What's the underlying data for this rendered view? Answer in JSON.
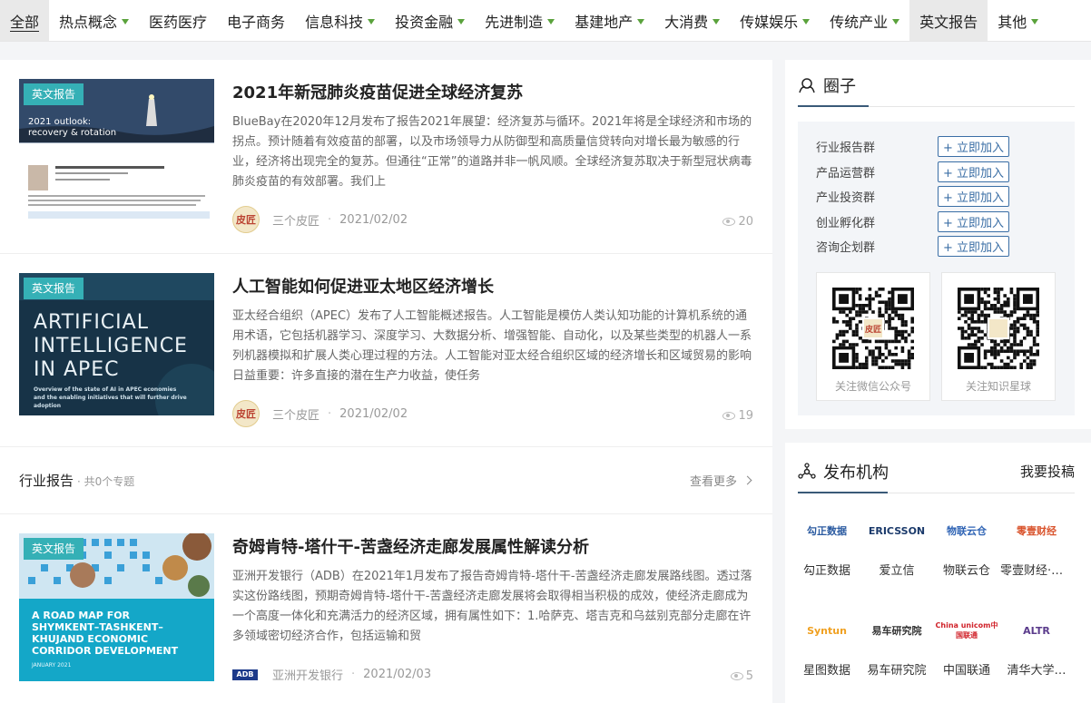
{
  "nav": {
    "items": [
      {
        "label": "全部",
        "caret": false
      },
      {
        "label": "热点概念",
        "caret": true
      },
      {
        "label": "医药医疗",
        "caret": false
      },
      {
        "label": "电子商务",
        "caret": false
      },
      {
        "label": "信息科技",
        "caret": true
      },
      {
        "label": "投资金融",
        "caret": true
      },
      {
        "label": "先进制造",
        "caret": true
      },
      {
        "label": "基建地产",
        "caret": true
      },
      {
        "label": "大消费",
        "caret": true
      },
      {
        "label": "传媒娱乐",
        "caret": true
      },
      {
        "label": "传统产业",
        "caret": true
      },
      {
        "label": "英文报告",
        "caret": false
      },
      {
        "label": "其他",
        "caret": true
      }
    ]
  },
  "articles": [
    {
      "badge": "英文报告",
      "thumb_lines": [
        "2021 outlook:",
        "recovery & rotation"
      ],
      "title": "2021年新冠肺炎疫苗促进全球经济复苏",
      "desc": "BlueBay在2020年12月发布了报告2021年展望：经济复苏与循环。2021年将是全球经济和市场的拐点。预计随着有效疫苗的部署，以及市场领导力从防御型和高质量信贷转向对增长最为敏感的行业，经济将出现完全的复苏。但通往“正常”的道路并非一帆风顺。全球经济复苏取决于新型冠状病毒肺炎疫苗的有效部署。我们上",
      "author": "三个皮匠",
      "avatar_text": "皮匠",
      "date": "2021/02/02",
      "views": "20"
    },
    {
      "badge": "英文报告",
      "thumb_lines": [
        "ARTIFICIAL",
        "INTELLIGENCE",
        "IN APEC",
        "Overview of the state of AI in APEC economies",
        "and the enabling initiatives that will further drive adoption"
      ],
      "title": "人工智能如何促进亚太地区经济增长",
      "desc": "亚太经合组织（APEC）发布了人工智能概述报告。人工智能是模仿人类认知功能的计算机系统的通用术语，它包括机器学习、深度学习、大数据分析、增强智能、自动化，以及某些类型的机器人一系列机器模拟和扩展人类心理过程的方法。人工智能对亚太经合组织区域的经济增长和区域贸易的影响日益重要：许多直接的潜在生产力收益，使任务",
      "author": "三个皮匠",
      "avatar_text": "皮匠",
      "date": "2021/02/02",
      "views": "19"
    },
    {
      "badge": "英文报告",
      "thumb_lines": [
        "A ROAD MAP FOR",
        "SHYMKENT–TASHKENT–",
        "KHUJAND ECONOMIC",
        "CORRIDOR DEVELOPMENT",
        "JANUARY 2021"
      ],
      "title": "奇姆肯特-塔什干-苦盏经济走廊发展属性解读分析",
      "desc": "亚洲开发银行（ADB）在2021年1月发布了报告奇姆肯特-塔什干-苦盏经济走廊发展路线图。透过落实这份路线图，预期奇姆肯特-塔什干-苦盏经济走廊发展将会取得相当积极的成效，使经济走廊成为一个高度一体化和充满活力的经济区域，拥有属性如下：1.哈萨克、塔吉克和乌兹别克部分走廊在许多领域密切经济合作，包括运输和贸",
      "author": "亚洲开发银行",
      "avatar_text": "ADB",
      "date": "2021/02/03",
      "views": "5"
    }
  ],
  "topics": {
    "title": "行业报告",
    "count": "· 共0个专题",
    "more": "查看更多"
  },
  "circle": {
    "title": "圈子",
    "groups": [
      {
        "name": "行业报告群",
        "join": "+ 立即加入"
      },
      {
        "name": "产品运营群",
        "join": "+ 立即加入"
      },
      {
        "name": "产业投资群",
        "join": "+ 立即加入"
      },
      {
        "name": "创业孵化群",
        "join": "+ 立即加入"
      },
      {
        "name": "咨询企划群",
        "join": "+ 立即加入"
      }
    ],
    "qr": [
      {
        "caption": "关注微信公众号",
        "center": "皮匠"
      },
      {
        "caption": "关注知识星球",
        "center": ""
      }
    ]
  },
  "publishers": {
    "title": "发布机构",
    "submit": "我要投稿",
    "orgs": [
      {
        "name": "勾正数据",
        "logo": "勾正数据",
        "color": "#2a5aa0"
      },
      {
        "name": "爱立信",
        "logo": "ERICSSON",
        "color": "#1b3a6b"
      },
      {
        "name": "物联云仓",
        "logo": "物联云仓",
        "color": "#2e63b4"
      },
      {
        "name": "零壹财经·零壹智库",
        "logo": "零壹财经",
        "color": "#d9532c"
      },
      {
        "name": "星图数据",
        "logo": "Syntun",
        "color": "#f0a020"
      },
      {
        "name": "易车研究院",
        "logo": "易车研究院",
        "color": "#333333"
      },
      {
        "name": "中国联通",
        "logo": "China unicom中国联通",
        "color": "#d0222a"
      },
      {
        "name": "清华大学…",
        "logo": "ALTR",
        "color": "#5b3c8c"
      }
    ]
  }
}
